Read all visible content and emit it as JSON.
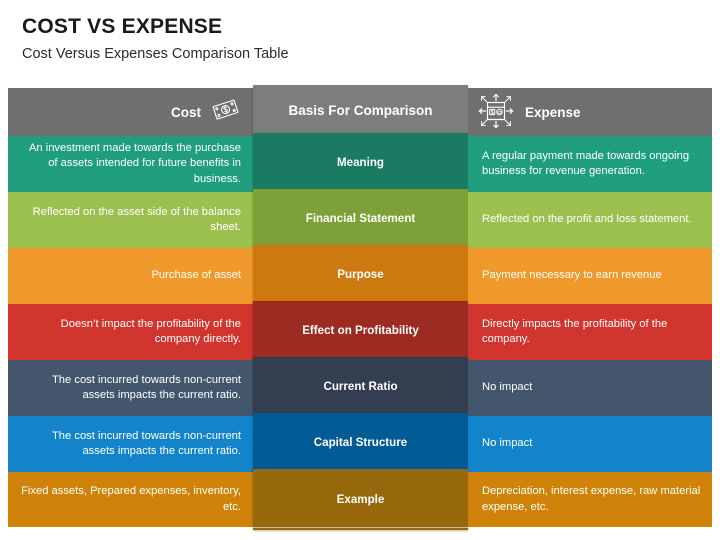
{
  "title": "COST VS EXPENSE",
  "subtitle": "Cost Versus Expenses Comparison Table",
  "header": {
    "left_label": "Cost",
    "middle_label": "Basis For Comparison",
    "right_label": "Expense",
    "left_icon": "banknote-dollar-icon",
    "right_icon": "expense-expand-icon"
  },
  "colors": {
    "header_side": "#6e6e6e",
    "header_middle": "#7d7d7d",
    "teal": "#1f9e7e",
    "teal_mid": "#1a7a62",
    "green": "#9cc04f",
    "green_mid": "#7da039",
    "orange": "#f0992b",
    "orange_mid": "#cc7a10",
    "red": "#d0342c",
    "red_mid": "#9e2b22",
    "slate": "#42556b",
    "slate_mid": "#333e50",
    "blue": "#1383c9",
    "blue_mid": "#035b95",
    "gold": "#ce8208",
    "gold_mid": "#97670b"
  },
  "columns": [
    "Cost",
    "Basis For Comparison",
    "Expense"
  ],
  "rows": [
    {
      "basis": "Meaning",
      "cost": "An investment made towards the purchase of assets intended for future benefits in business.",
      "expense": "A regular payment made towards ongoing business for revenue generation."
    },
    {
      "basis": "Financial Statement",
      "cost": "Reflected on the asset side of the balance sheet.",
      "expense": "Reflected on the profit and loss statement."
    },
    {
      "basis": "Purpose",
      "cost": "Purchase of asset",
      "expense": "Payment necessary to earn revenue"
    },
    {
      "basis": "Effect on Profitability",
      "cost": "Doesn’t impact the profitability of the company directly.",
      "expense": "Directly impacts the profitability of the company."
    },
    {
      "basis": "Current Ratio",
      "cost": "The cost incurred towards non-current assets impacts the current ratio.",
      "expense": "No impact"
    },
    {
      "basis": "Capital Structure",
      "cost": "The cost incurred towards non-current assets impacts the current ratio.",
      "expense": "No impact"
    },
    {
      "basis": "Example",
      "cost": "Fixed assets, Prepared expenses, inventory, etc.",
      "expense": "Depreciation, interest expense, raw material expense, etc."
    }
  ]
}
